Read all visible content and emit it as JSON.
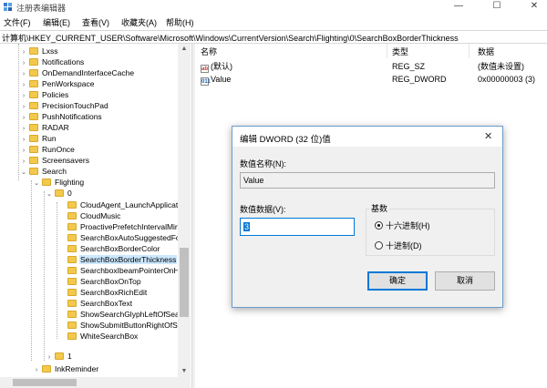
{
  "window": {
    "title": "注册表编辑器",
    "minimize_glyph": "—",
    "maximize_glyph": "☐",
    "close_glyph": "✕"
  },
  "menu": [
    "文件(F)",
    "编辑(E)",
    "查看(V)",
    "收藏夹(A)",
    "帮助(H)"
  ],
  "address": "计算机\\HKEY_CURRENT_USER\\Software\\Microsoft\\Windows\\CurrentVersion\\Search\\Flighting\\0\\SearchBoxBorderThickness",
  "tree": [
    {
      "label": "Lxss"
    },
    {
      "label": "Notifications"
    },
    {
      "label": "OnDemandInterfaceCache"
    },
    {
      "label": "PenWorkspace"
    },
    {
      "label": "Policies"
    },
    {
      "label": "PrecisionTouchPad"
    },
    {
      "label": "PushNotifications"
    },
    {
      "label": "RADAR"
    },
    {
      "label": "Run"
    },
    {
      "label": "RunOnce"
    },
    {
      "label": "Screensavers"
    },
    {
      "label": "Search",
      "expanded": true
    },
    {
      "label": "Flighting",
      "expanded": true
    },
    {
      "label": "0",
      "expanded": true
    },
    {
      "label": "CloudAgent_LaunchApplicati"
    },
    {
      "label": "CloudMusic"
    },
    {
      "label": "ProactivePrefetchIntervalMin"
    },
    {
      "label": "SearchBoxAutoSuggestedFo"
    },
    {
      "label": "SearchBoxBorderColor"
    },
    {
      "label": "SearchBoxBorderThickness",
      "selected": true
    },
    {
      "label": "SearchboxIbeamPointerOnH"
    },
    {
      "label": "SearchBoxOnTop"
    },
    {
      "label": "SearchBoxRichEdit"
    },
    {
      "label": "SearchBoxText"
    },
    {
      "label": "ShowSearchGlyphLeftOfSear"
    },
    {
      "label": "ShowSubmitButtonRightOfSe"
    },
    {
      "label": "WhiteSearchBox"
    },
    {
      "label": "1"
    },
    {
      "label": "InkReminder"
    }
  ],
  "list": {
    "headers": {
      "name": "名称",
      "type": "类型",
      "data": "数据"
    },
    "rows": [
      {
        "icon": "ab",
        "name": "(默认)",
        "type": "REG_SZ",
        "data": "(数值未设置)"
      },
      {
        "icon": "011",
        "name": "Value",
        "type": "REG_DWORD",
        "data": "0x00000003 (3)"
      }
    ]
  },
  "dialog": {
    "title": "编辑 DWORD (32 位)值",
    "close_glyph": "✕",
    "value_name_label": "数值名称(N):",
    "value_name": "Value",
    "value_data_label": "数值数据(V):",
    "value_data": "3",
    "base_label": "基数",
    "hex_label": "十六进制(H)",
    "dec_label": "十进制(D)",
    "selected_base": "hex",
    "ok_label": "确定",
    "cancel_label": "取消"
  },
  "colors": {
    "selection": "#cce8ff",
    "accent": "#0078d7",
    "folder": "#f2c94c"
  }
}
